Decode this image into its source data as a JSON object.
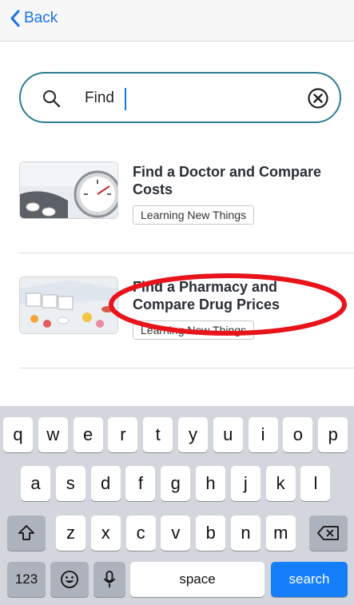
{
  "nav": {
    "back_label": "Back"
  },
  "search": {
    "value": "Find",
    "placeholder": ""
  },
  "results": [
    {
      "title": "Find a Doctor and Compare Costs",
      "tag": "Learning New Things",
      "image": "blood-pressure-gauge-and-pills"
    },
    {
      "title": "Find a Pharmacy and Compare Drug Prices",
      "tag": "Learning New Things",
      "image": "pill-organizer-and-pills"
    }
  ],
  "annotation": {
    "shape": "ellipse",
    "color": "#e8131b"
  },
  "keyboard": {
    "row1": [
      "q",
      "w",
      "e",
      "r",
      "t",
      "y",
      "u",
      "i",
      "o",
      "p"
    ],
    "row2": [
      "a",
      "s",
      "d",
      "f",
      "g",
      "h",
      "j",
      "k",
      "l"
    ],
    "row3": [
      "z",
      "x",
      "c",
      "v",
      "b",
      "n",
      "m"
    ],
    "shift_icon": "shift-icon",
    "backspace_icon": "backspace-icon",
    "numbers_label": "123",
    "emoji_icon": "emoji-icon",
    "mic_icon": "microphone-icon",
    "space_label": "space",
    "search_label": "search"
  },
  "colors": {
    "accent": "#1a73e8",
    "search_border": "#2d7d91",
    "search_key": "#147efb",
    "keyboard_bg": "#d3d6dd"
  }
}
